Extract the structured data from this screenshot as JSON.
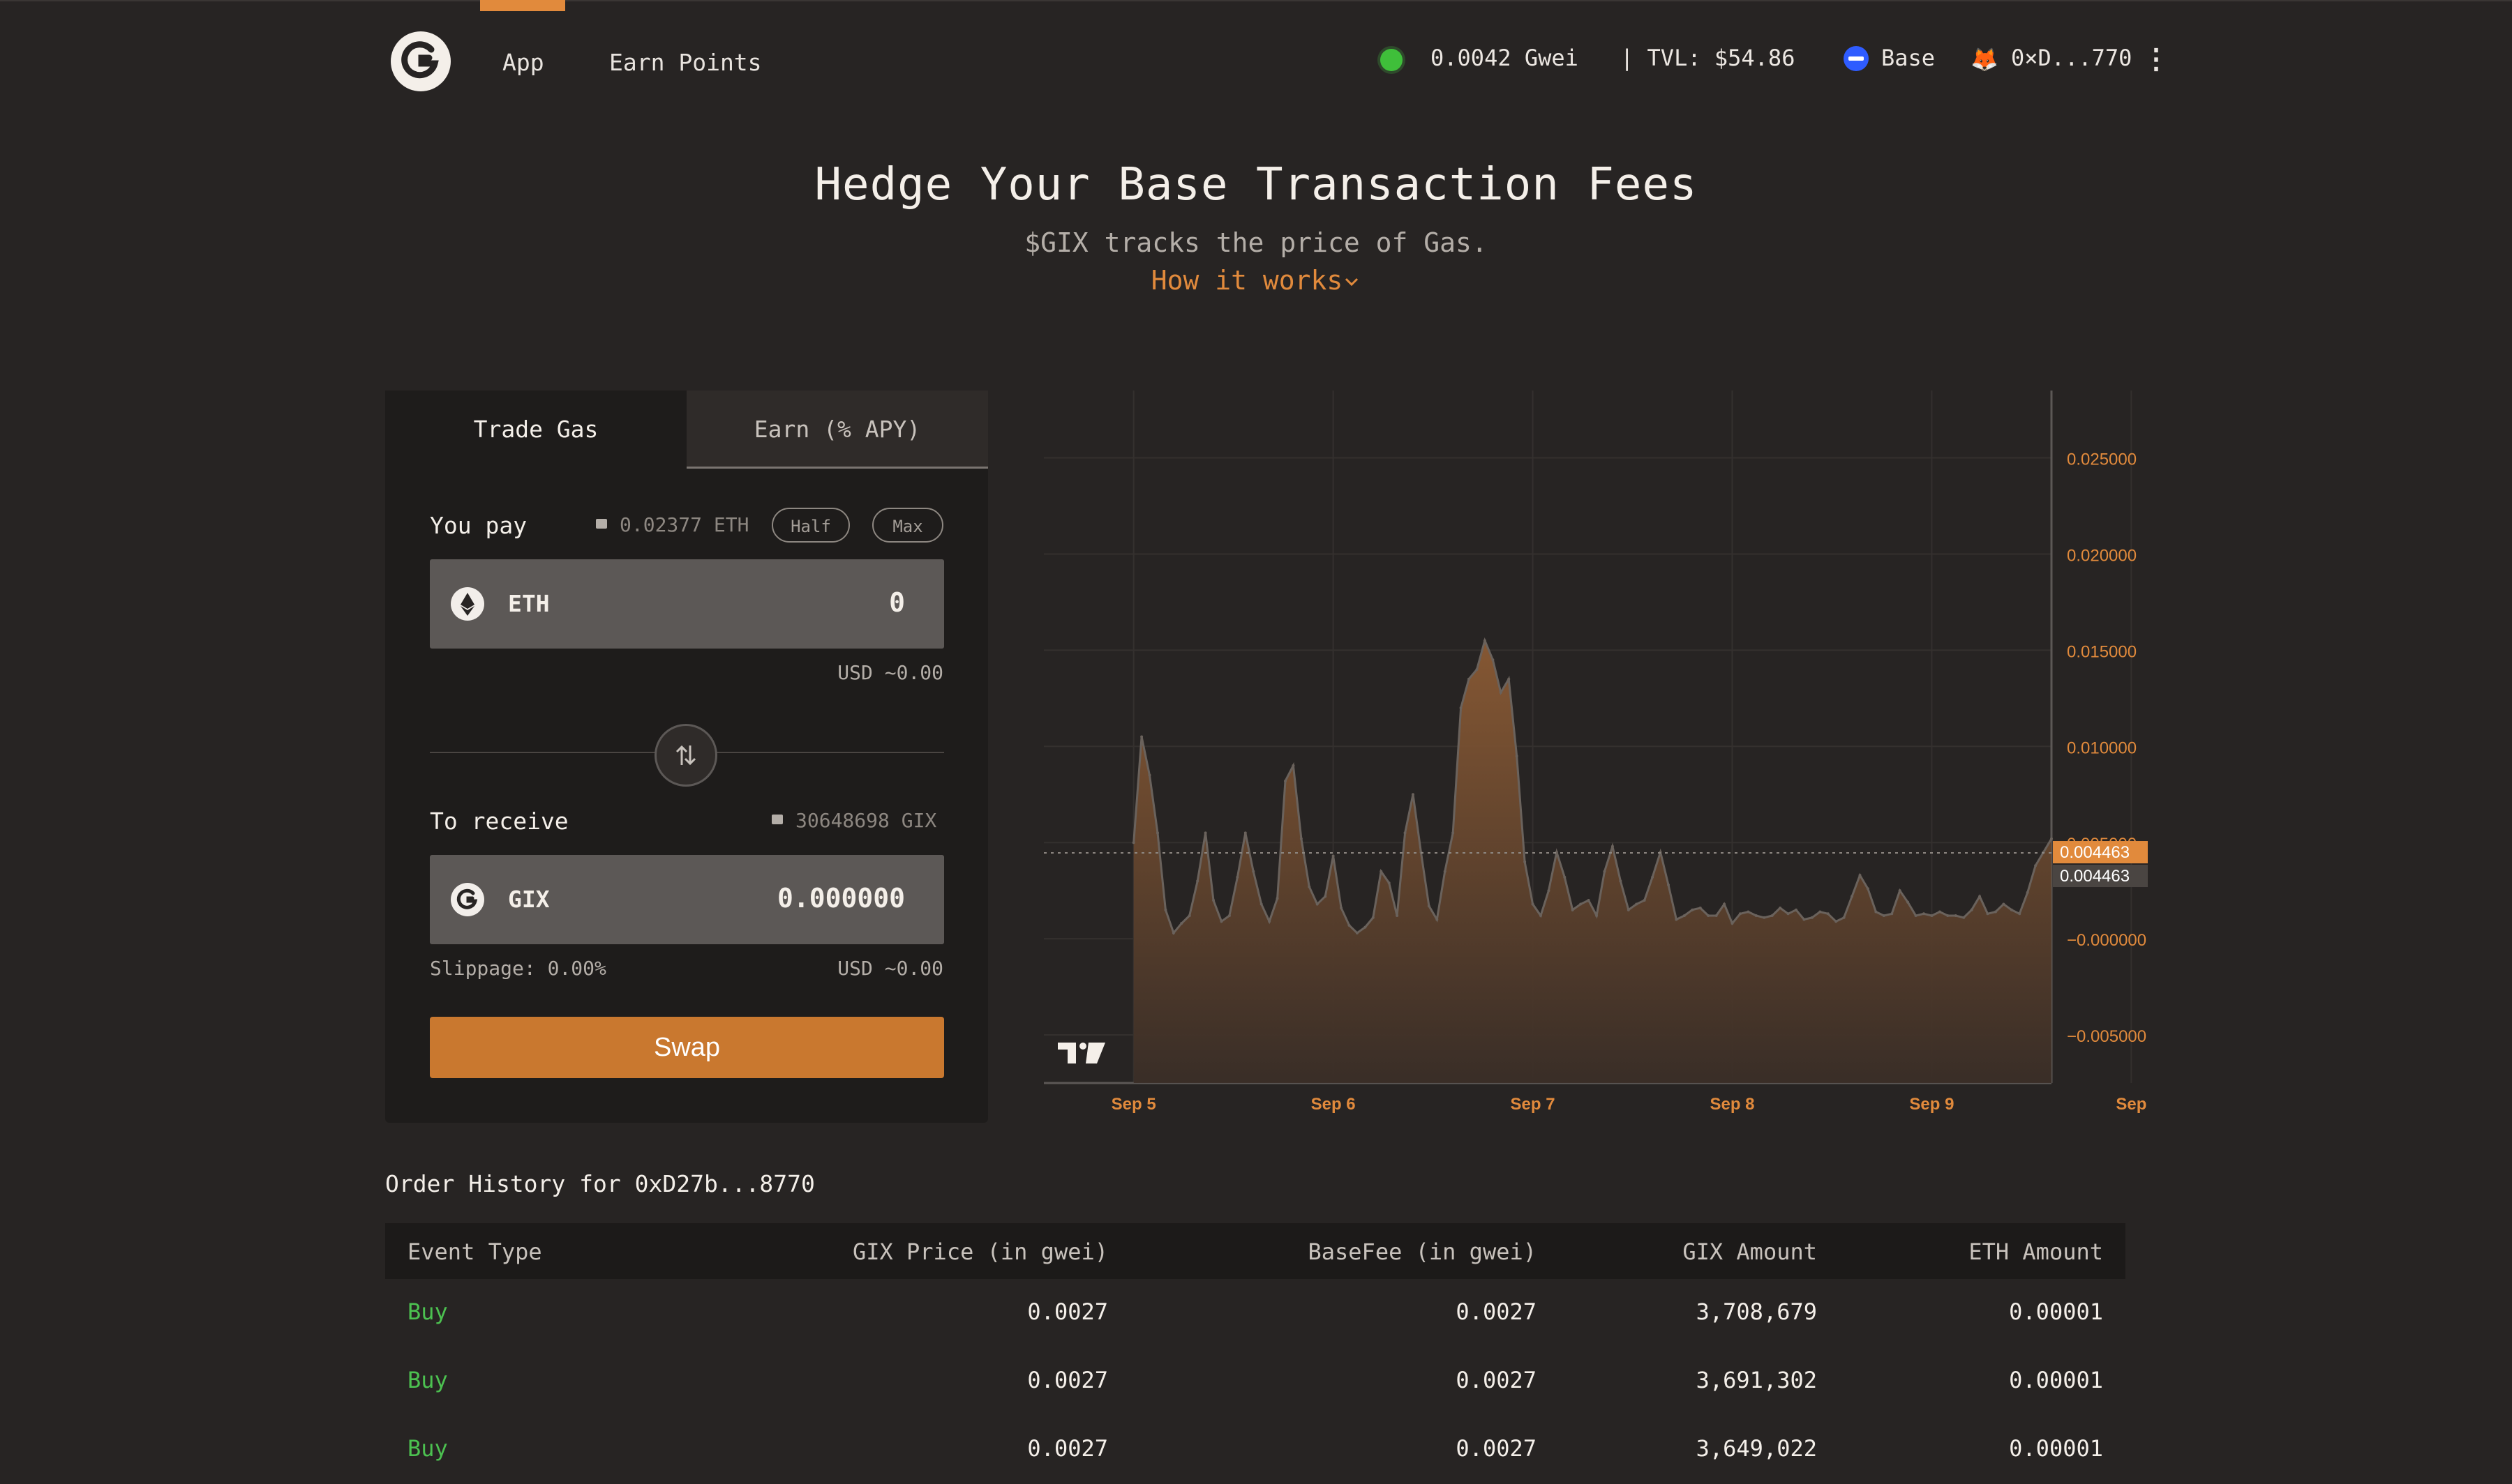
{
  "nav": {
    "items": [
      {
        "label": "App",
        "active": true
      },
      {
        "label": "Earn Points",
        "active": false
      }
    ],
    "gas_price": "0.0042 Gwei",
    "tvl": "| TVL: $54.86",
    "network": "Base",
    "wallet": "0×D...770",
    "menu_icon": "more-vertical-icon",
    "accent_color": "#e18a3c"
  },
  "hero": {
    "title": "Hedge Your Base Transaction Fees",
    "subtitle": "$GIX tracks the price of Gas.",
    "link": "How it works"
  },
  "trade": {
    "tabs": [
      "Trade Gas",
      "Earn (% APY)"
    ],
    "pay": {
      "label": "You pay",
      "balance": "0.02377 ETH",
      "half_label": "Half",
      "max_label": "Max",
      "token": "ETH",
      "amount": "0",
      "usd": "USD ~0.00"
    },
    "receive": {
      "label": "To receive",
      "balance": "30648698 GIX",
      "token": "GIX",
      "amount": "0.000000",
      "usd": "USD ~0.00",
      "slippage": "Slippage: 0.00%"
    },
    "swap_label": "Swap",
    "swap_color": "#c9782f"
  },
  "chart_data": {
    "type": "area",
    "x_labels": [
      "Sep 5",
      "Sep 6",
      "Sep 7",
      "Sep 8",
      "Sep 9",
      "Sep"
    ],
    "y_ticks": [
      "0.025000",
      "0.020000",
      "0.015000",
      "0.010000",
      "0.005000",
      "−0.000000",
      "−0.005000"
    ],
    "y_tick_values": [
      0.025,
      0.02,
      0.015,
      0.01,
      0.005,
      0.0,
      -0.005
    ],
    "ylim": [
      -0.0075,
      0.0285
    ],
    "grid": true,
    "current_value_labels": [
      "0.004463",
      "0.004463"
    ],
    "current_value": 0.004463,
    "watermark": "TV",
    "series": [
      {
        "color": "#c9782f",
        "x": [
          5.0,
          5.04,
          5.08,
          5.12,
          5.16,
          5.2,
          5.24,
          5.28,
          5.32,
          5.36,
          5.4,
          5.44,
          5.48,
          5.52,
          5.56,
          5.6,
          5.64,
          5.68,
          5.72,
          5.76,
          5.8,
          5.84,
          5.88,
          5.92,
          5.96,
          6.0,
          6.04,
          6.08,
          6.12,
          6.16,
          6.2,
          6.24,
          6.28,
          6.32,
          6.36,
          6.4,
          6.44,
          6.48,
          6.52,
          6.56,
          6.6,
          6.64,
          6.68,
          6.72,
          6.76,
          6.8,
          6.84,
          6.88,
          6.92,
          6.96,
          7.0,
          7.04,
          7.08,
          7.12,
          7.16,
          7.2,
          7.24,
          7.28,
          7.32,
          7.36,
          7.4,
          7.44,
          7.48,
          7.52,
          7.56,
          7.6,
          7.64,
          7.68,
          7.72,
          7.76,
          7.8,
          7.84,
          7.88,
          7.92,
          7.96,
          8.0,
          8.04,
          8.08,
          8.12,
          8.16,
          8.2,
          8.24,
          8.28,
          8.32,
          8.36,
          8.4,
          8.44,
          8.48,
          8.52,
          8.56,
          8.6,
          8.64,
          8.68,
          8.72,
          8.76,
          8.8,
          8.84,
          8.88,
          8.92,
          8.96,
          9.0,
          9.04,
          9.08,
          9.12,
          9.16,
          9.2,
          9.24,
          9.28,
          9.32,
          9.36,
          9.4,
          9.44,
          9.48,
          9.52,
          9.56,
          9.6
        ],
        "y": [
          0.005,
          0.0105,
          0.0085,
          0.0055,
          0.0015,
          0.0003,
          0.0008,
          0.0012,
          0.003,
          0.0055,
          0.002,
          0.0009,
          0.0012,
          0.0032,
          0.0055,
          0.0035,
          0.0018,
          0.0009,
          0.0021,
          0.0082,
          0.009,
          0.0052,
          0.0027,
          0.0018,
          0.0022,
          0.0043,
          0.0016,
          0.0007,
          0.0003,
          0.0006,
          0.0011,
          0.0035,
          0.0029,
          0.0012,
          0.0055,
          0.0075,
          0.0045,
          0.0017,
          0.001,
          0.0035,
          0.0055,
          0.012,
          0.0135,
          0.014,
          0.0155,
          0.0145,
          0.0128,
          0.0135,
          0.0095,
          0.004,
          0.0018,
          0.0012,
          0.0025,
          0.0045,
          0.0032,
          0.0015,
          0.0018,
          0.002,
          0.0012,
          0.0035,
          0.0048,
          0.003,
          0.0015,
          0.0018,
          0.002,
          0.0032,
          0.0045,
          0.0028,
          0.001,
          0.0012,
          0.0015,
          0.0016,
          0.0012,
          0.0012,
          0.0018,
          0.0008,
          0.0013,
          0.0014,
          0.0012,
          0.0011,
          0.0012,
          0.0016,
          0.0013,
          0.0015,
          0.001,
          0.0011,
          0.0014,
          0.0013,
          0.0009,
          0.0011,
          0.0022,
          0.0033,
          0.0026,
          0.0014,
          0.0012,
          0.0013,
          0.0025,
          0.0019,
          0.0012,
          0.0013,
          0.0012,
          0.0014,
          0.0012,
          0.0012,
          0.0011,
          0.0015,
          0.0022,
          0.0013,
          0.0014,
          0.0018,
          0.0015,
          0.0013,
          0.0024,
          0.0038,
          0.0045,
          0.0052
        ]
      }
    ]
  },
  "order_history": {
    "title": "Order History for 0xD27b...8770",
    "columns": [
      "Event Type",
      "GIX Price (in gwei)",
      "BaseFee (in gwei)",
      "GIX Amount",
      "ETH Amount"
    ],
    "rows": [
      [
        "Buy",
        "0.0027",
        "0.0027",
        "3,708,679",
        "0.00001"
      ],
      [
        "Buy",
        "0.0027",
        "0.0027",
        "3,691,302",
        "0.00001"
      ],
      [
        "Buy",
        "0.0027",
        "0.0027",
        "3,649,022",
        "0.00001"
      ]
    ],
    "buy_color": "#4cc150"
  }
}
